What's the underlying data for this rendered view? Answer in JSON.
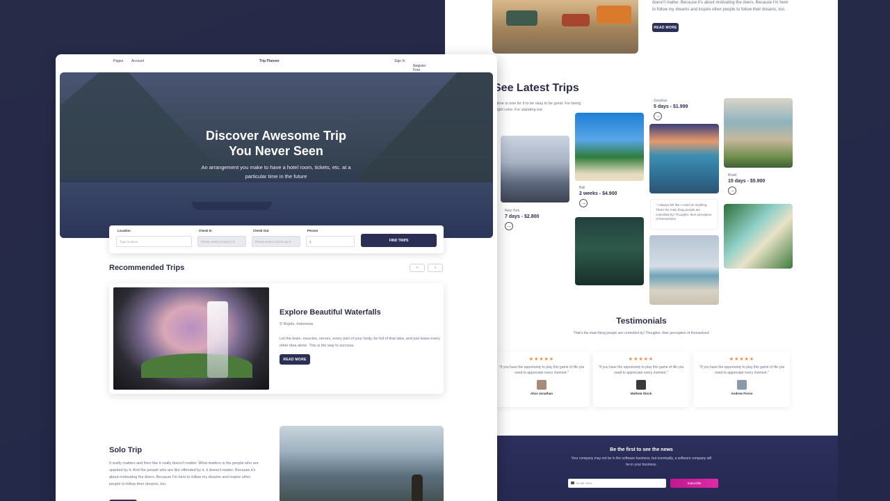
{
  "front": {
    "nav": {
      "pages": "Pages",
      "account": "Account",
      "brand": "Trip Planner",
      "signin": "Sign In",
      "register": "Register Free"
    },
    "hero": {
      "title_line1": "Discover Awesome Trip",
      "title_line2": "You Never Seen",
      "subtitle": "An arrangement you make to have a hotel room, tickets, etc. at a particular time in the future"
    },
    "search": {
      "location_label": "Location",
      "location_placeholder": "Type location",
      "checkin_label": "Check In",
      "checkin_placeholder": "Please select check-in d",
      "checkout_label": "Check Out",
      "checkout_placeholder": "Please select check-out d",
      "person_label": "Person",
      "person_value": "1",
      "button": "FIND TRIPS"
    },
    "recommended": {
      "title": "Recommended Trips",
      "prev": "‹",
      "next": "›",
      "card": {
        "title": "Explore Beautiful Waterfalls",
        "location": "Rojelo, Indonesia",
        "description": "Let the brain, muscles, nerves, every part of your body, be full of that idea, and just leave every other idea alone. This is the way to success.",
        "button": "READ MORE"
      }
    },
    "solo": {
      "title": "Solo Trip",
      "description": "It really matters and then like it really doesn't matter. What matters is the people who are sparked by it. And the people who are like offended by it, it doesn't matter. Because it's about motivating the doers. Because I'm here to follow my dreams and inspire other people to follow their dreams, too."
    }
  },
  "back": {
    "top_text": "doesn't matter. Because it's about motivating the doers. Because I'm here to follow my dreams and inspire other people to follow their dreams, too.",
    "read_more": "READ MORE",
    "latest": {
      "title": "See Latest Trips",
      "subtitle": "e time is now for it to be okay to be great. For being bright color. For standing out.",
      "trips": [
        {
          "place": "New York",
          "price": "7 days - $2.800"
        },
        {
          "place": "Bali",
          "price": "2 weeks - $4.900"
        },
        {
          "place": "Zanzibar",
          "price": "5 days - $1.999"
        },
        {
          "place": "Brazil",
          "price": "15 days - $5.900"
        }
      ],
      "quote": "\" I always felt like I could do anything. That's the main thing people are controlled by! Thoughts- their perception of themselves!"
    },
    "testimonials": {
      "title": "Testimonials",
      "subtitle": "That's the main thing people are controlled by! Thoughts- their perception of themselves!",
      "stars": "★★★★★",
      "items": [
        {
          "quote": "\"If you have the opportunity to play this game of life you need to appreciate every moment.\"",
          "name": "Alice Jonathan"
        },
        {
          "quote": "\"If you have the opportunity to play this game of life you need to appreciate every moment.\"",
          "name": "Mathew Glock"
        },
        {
          "quote": "\"If you have the opportunity to play this game of life you need to appreciate every moment.\"",
          "name": "Andrew Fierce"
        }
      ]
    },
    "newsletter": {
      "title": "Be the first to see the news",
      "subtitle": "Your company may not be in the software business, but eventually, a software company will be in your business.",
      "placeholder": "Email Here...",
      "button": "Subscribe"
    }
  },
  "colors": {
    "navy": "#2b2e55",
    "accent_pink": "#e02aa7",
    "star": "#f08a3c",
    "background": "#272b48"
  }
}
